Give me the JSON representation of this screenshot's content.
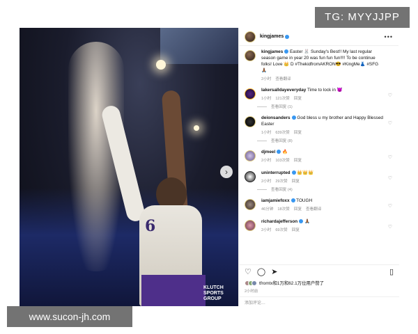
{
  "post": {
    "username": "kingjames",
    "more_icon": "more-icon"
  },
  "caption": {
    "username": "kingjames",
    "text": "Easter 🐰 Sunday's Best!! My last regular season game in year 20 was fun fun fun!!!! To be continue folks! Love 👑 D #ThekidfromAKRON😎 #KingMe👗 #SFG🙏🏾",
    "time": "2小时",
    "translate": "查看翻译"
  },
  "comments": [
    {
      "username": "lakersalldayeveryday",
      "text": "Time to lock in 😈",
      "time": "1小时",
      "likes": "121次赞",
      "reply": "回复",
      "view_replies": "查看回复 (1)"
    },
    {
      "username": "deionsanders",
      "text": "God bless u my brother and Happy Blessed Easter",
      "time": "1小时",
      "likes": "639次赞",
      "reply": "回复",
      "view_replies": "查看回复 (8)"
    },
    {
      "username": "djmeel",
      "text": "🔥",
      "time": "2小时",
      "likes": "103次赞",
      "reply": "回复",
      "view_replies": ""
    },
    {
      "username": "uninterrupted",
      "text": "👑👑👑",
      "time": "2小时",
      "likes": "29次赞",
      "reply": "回复",
      "view_replies": "查看回复 (4)"
    },
    {
      "username": "iamjamiefoxx",
      "text": "TOUGH",
      "time": "46分钟",
      "likes": "18次赞",
      "reply": "回复",
      "view_replies": "查看翻译"
    },
    {
      "username": "richardajefferson",
      "text": "🙏🏾",
      "time": "2小时",
      "likes": "69次赞",
      "reply": "回复",
      "view_replies": ""
    }
  ],
  "likes": {
    "text": "tfromtx和1万和62.1万位用户赞了"
  },
  "time_ago": "2小时前",
  "add_comment_placeholder": "添加评论…",
  "watermark_top": "TG: MYYJJPP",
  "watermark_bottom": "www.sucon-jh.com",
  "photo": {
    "jersey_number": "6",
    "sponsor": "KLUTCH SPORTS GROUP"
  }
}
